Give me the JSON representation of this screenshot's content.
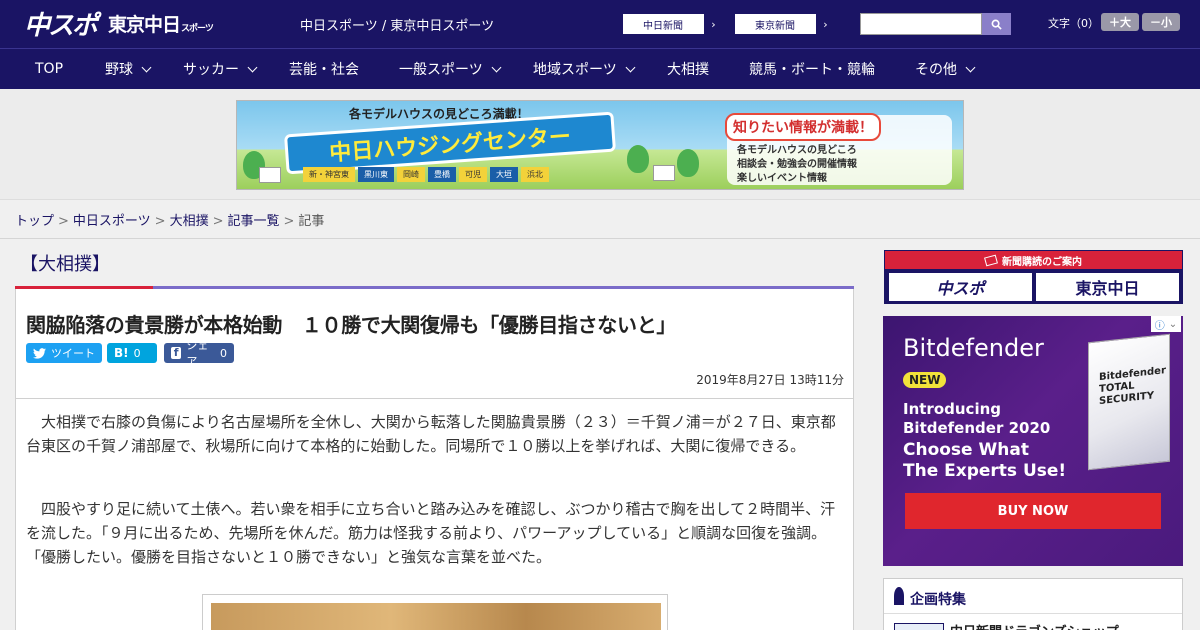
{
  "header": {
    "logo_chunichi_sports": "中スポ",
    "logo_tokyo_chunichi_sports": "東京中日",
    "logo_tokyo_sub": "スポーツ",
    "site_title": "中日スポーツ / 東京中日スポーツ",
    "paper_links": [
      "中日新聞",
      "東京新聞"
    ],
    "search_placeholder": "",
    "font_size_label": "文字（0）",
    "font_up": "＋大",
    "font_down": "－小"
  },
  "nav": {
    "items": [
      {
        "label": "TOP",
        "dropdown": false
      },
      {
        "label": "野球",
        "dropdown": true
      },
      {
        "label": "サッカー",
        "dropdown": true
      },
      {
        "label": "芸能・社会",
        "dropdown": false
      },
      {
        "label": "一般スポーツ",
        "dropdown": true
      },
      {
        "label": "地域スポーツ",
        "dropdown": true
      },
      {
        "label": "大相撲",
        "dropdown": false
      },
      {
        "label": "競馬・ボート・競輪",
        "dropdown": false
      },
      {
        "label": "その他",
        "dropdown": true
      }
    ]
  },
  "banner": {
    "top_text": "各モデルハウスの見どころ満載！",
    "main_text": "中日ハウジングセンター",
    "cities": [
      "新・神宮東",
      "黒川東",
      "岡崎",
      "豊橋",
      "可児",
      "大垣",
      "浜北"
    ],
    "right_title": "知りたい情報が満載！",
    "right_lines": [
      "各モデルハウスの見どころ",
      "相談会・勉強会の開催情報",
      "楽しいイベント情報"
    ]
  },
  "breadcrumb": {
    "items": [
      "トップ",
      "中日スポーツ",
      "大相撲",
      "記事一覧"
    ],
    "current": "記事"
  },
  "article": {
    "section": "【大相撲】",
    "headline": "関脇陥落の貴景勝が本格始動　１０勝で大関復帰も「優勝目指さないと」",
    "share": {
      "tweet": "ツイート",
      "hatena": "B!",
      "hatena_count": "0",
      "facebook": "シェア",
      "facebook_count": "0"
    },
    "date": "2019年8月27日 13時11分",
    "paragraphs": [
      "大相撲で右膝の負傷により名古屋場所を全休し、大関から転落した関脇貴景勝（２３）＝千賀ノ浦＝が２７日、東京都台東区の千賀ノ浦部屋で、秋場所に向けて本格的に始動した。同場所で１０勝以上を挙げれば、大関に復帰できる。",
      "四股やすり足に続いて土俵へ。若い衆を相手に立ち合いと踏み込みを確認し、ぶつかり稽古で胸を出して２時間半、汗を流した。「９月に出るため、先場所を休んだ。筋力は怪我する前より、パワーアップしている」と順調な回復を強調。「優勝したい。優勝を目指さないと１０勝できない」と強気な言葉を並べた。"
    ]
  },
  "sidebar": {
    "subscribe_header": "新聞購読のご案内",
    "subscribe_logos": [
      "中スポ",
      "東京中日"
    ],
    "ad": {
      "brand": "Bitdefender",
      "badge": "NEW",
      "line1": "Introducing",
      "line2": "Bitdefender 2020",
      "line3": "Choose What",
      "line4": "The Experts Use!",
      "box_label": "Bitdefender TOTAL SECURITY",
      "cta": "BUY NOW"
    },
    "feature_title": "企画特集",
    "feature_item": "中日新聞ドラゴンズショップ"
  },
  "colors": {
    "brand_navy": "#1a1464",
    "accent_red": "#d8223a",
    "accent_purple": "#7b6cc9",
    "twitter": "#1da1f2",
    "hatena": "#00a4de",
    "facebook": "#3b5998"
  }
}
